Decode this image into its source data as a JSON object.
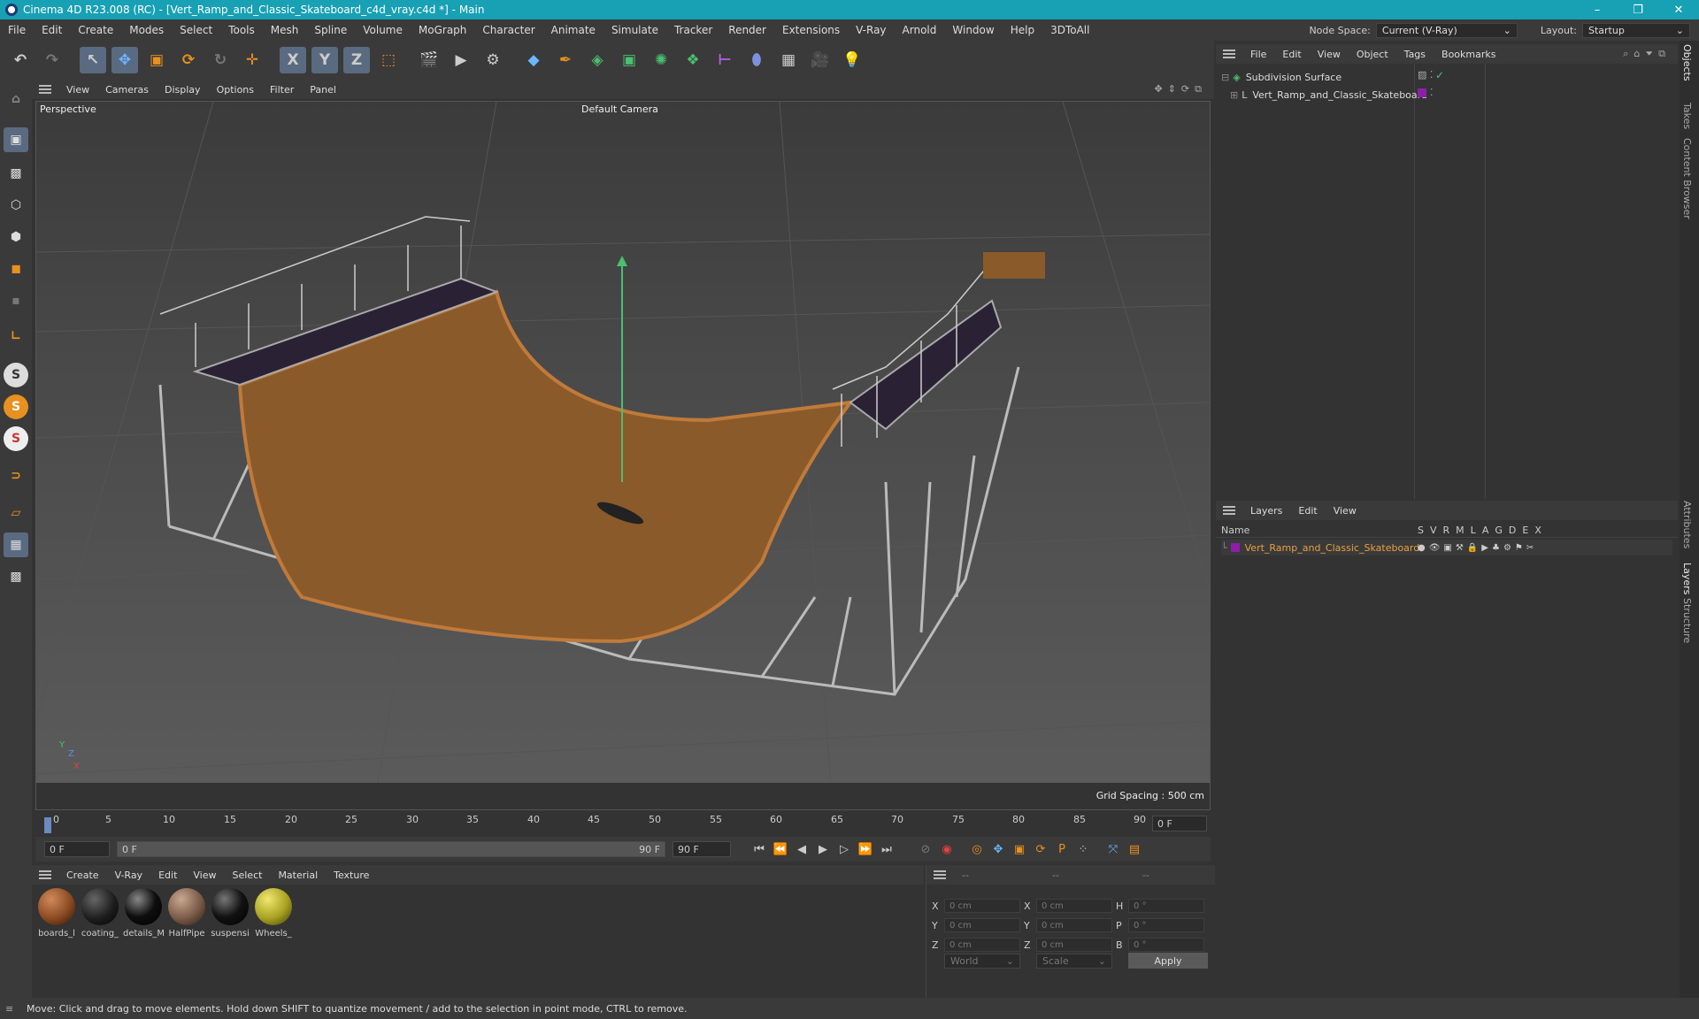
{
  "window": {
    "title": "Cinema 4D R23.008 (RC) - [Vert_Ramp_and_Classic_Skateboard_c4d_vray.c4d *] - Main"
  },
  "menubar": {
    "items": [
      "File",
      "Edit",
      "Create",
      "Modes",
      "Select",
      "Tools",
      "Mesh",
      "Spline",
      "Volume",
      "MoGraph",
      "Character",
      "Animate",
      "Simulate",
      "Tracker",
      "Render",
      "Extensions",
      "V-Ray",
      "Arnold",
      "Window",
      "Help",
      "3DToAll"
    ],
    "node_space_label": "Node Space:",
    "node_space_value": "Current (V-Ray)",
    "layout_label": "Layout:",
    "layout_value": "Startup"
  },
  "toolbar": {
    "axis_x": "X",
    "axis_y": "Y",
    "axis_z": "Z"
  },
  "left_tools": {
    "s1": "S",
    "s2": "S",
    "s3": "S"
  },
  "viewport_menu": {
    "items": [
      "View",
      "Cameras",
      "Display",
      "Options",
      "Filter",
      "Panel"
    ]
  },
  "viewport": {
    "projection": "Perspective",
    "camera": "Default Camera",
    "grid_spacing": "Grid Spacing : 500 cm",
    "axis_y": "Y",
    "axis_z": "Z",
    "axis_x": "X"
  },
  "timeline": {
    "ticks": [
      "0",
      "5",
      "10",
      "15",
      "20",
      "25",
      "30",
      "35",
      "40",
      "45",
      "50",
      "55",
      "60",
      "65",
      "70",
      "75",
      "80",
      "85",
      "90"
    ],
    "current_frame": "0 F"
  },
  "transport": {
    "start_frame": "0 F",
    "range_start": "0 F",
    "range_end": "90 F",
    "end_frame": "90 F",
    "param_p": "P"
  },
  "material_menu": {
    "items": [
      "Create",
      "V-Ray",
      "Edit",
      "View",
      "Select",
      "Material",
      "Texture"
    ]
  },
  "materials": [
    {
      "name": "boards_l",
      "color": "#8a4a22"
    },
    {
      "name": "coating_",
      "color": "#1e1e1e"
    },
    {
      "name": "details_M",
      "color": "#0e0e0e"
    },
    {
      "name": "HalfPipe",
      "color": "#7a5a48"
    },
    {
      "name": "suspensi",
      "color": "#121212"
    },
    {
      "name": "Wheels_",
      "color": "#a8a020"
    }
  ],
  "coords": {
    "header": [
      "--",
      "--",
      "--"
    ],
    "labels": {
      "x": "X",
      "y": "Y",
      "z": "Z",
      "x2": "X",
      "y2": "Y",
      "z2": "Z",
      "h": "H",
      "p": "P",
      "b": "B"
    },
    "x_pos": "0 cm",
    "y_pos": "0 cm",
    "z_pos": "0 cm",
    "x_size": "0 cm",
    "y_size": "0 cm",
    "z_size": "0 cm",
    "h_rot": "0 °",
    "p_rot": "0 °",
    "b_rot": "0 °",
    "mode": "World",
    "scale": "Scale",
    "apply": "Apply"
  },
  "status": {
    "text": "Move: Click and drag to move elements. Hold down SHIFT to quantize movement / add to the selection in point mode, CTRL to remove."
  },
  "objects_menu": {
    "items": [
      "File",
      "Edit",
      "View",
      "Object",
      "Tags",
      "Bookmarks"
    ]
  },
  "objects": [
    {
      "name": "Subdivision Surface"
    },
    {
      "name": "Vert_Ramp_and_Classic_Skateboard"
    }
  ],
  "layers_menu": {
    "items": [
      "Layers",
      "Edit",
      "View"
    ]
  },
  "layers": {
    "name_header": "Name",
    "flags": [
      "S",
      "V",
      "R",
      "M",
      "L",
      "A",
      "G",
      "D",
      "E",
      "X"
    ],
    "rows": [
      {
        "name": "Vert_Ramp_and_Classic_Skateboard",
        "color": "#8b1fa8"
      }
    ]
  },
  "side_tabs": [
    "Objects",
    "Takes",
    "Content Browser",
    "Attributes",
    "Layers",
    "Structure"
  ],
  "colors": {
    "accent_teal": "#18a0b4",
    "layer_orange": "#e8a040",
    "ramp_brown": "#8a5a2a"
  }
}
